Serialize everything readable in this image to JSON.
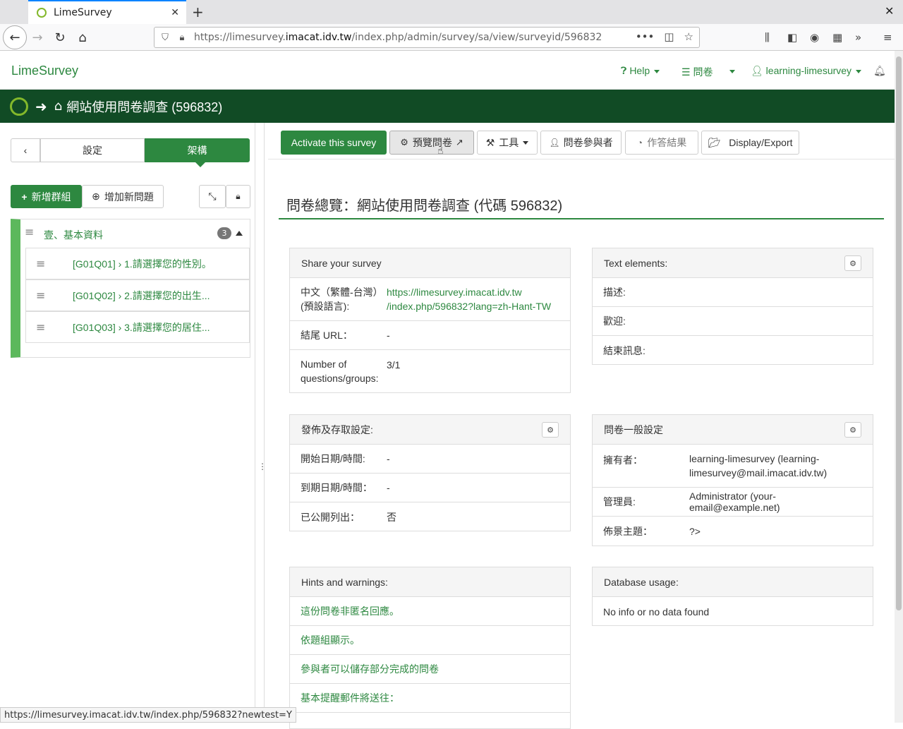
{
  "browser": {
    "tab_title": "LimeSurvey",
    "url_prefix": "https://limesurvey.",
    "url_domain": "imacat.idv.tw",
    "url_path": "/index.php/admin/survey/sa/view/surveyid/596832",
    "status_url": "https://limesurvey.imacat.idv.tw/index.php/596832?newtest=Y"
  },
  "header": {
    "brand": "LimeSurvey",
    "help": "Help",
    "surveys": "問卷",
    "user": "learning-limesurvey"
  },
  "titlebar": {
    "title": "網站使用問卷調查",
    "id": "(596832)"
  },
  "sidebar": {
    "tab_settings": "設定",
    "tab_structure": "架構",
    "add_group": "新增群組",
    "add_question": "增加新問題",
    "group": {
      "name": "壹、基本資料",
      "count": "3",
      "questions": [
        "[G01Q01] › 1.請選擇您的性別。",
        "[G01Q02] › 2.請選擇您的出生...",
        "[G01Q03] › 3.請選擇您的居住..."
      ]
    }
  },
  "toolbar": {
    "activate": "Activate this survey",
    "preview": "預覽問卷",
    "tools": "工具",
    "participants": "問卷參與者",
    "responses": "作答結果",
    "export": "Display/Export"
  },
  "overview": {
    "title_prefix": "問卷總覽：網站使用問卷調查",
    "title_code": "(代碼 596832)"
  },
  "share": {
    "heading": "Share your survey",
    "lang_label": "中文（繁體-台灣）(預設語言):",
    "link_line1": "https://limesurvey.imacat.idv.tw",
    "link_line2": "/index.php/596832?lang=zh-Hant-TW",
    "end_url_label": "結尾 URL：",
    "end_url_value": "-",
    "count_label": "Number of questions/groups:",
    "count_value": "3/1"
  },
  "text_elements": {
    "heading": "Text elements:",
    "description": "描述:",
    "welcome": "歡迎:",
    "end_message": "結束訊息:"
  },
  "publish": {
    "heading": "發佈及存取設定:",
    "start_label": "開始日期/時間:",
    "start_value": "-",
    "expiry_label": "到期日期/時間：",
    "expiry_value": "-",
    "public_label": "已公開列出：",
    "public_value": "否"
  },
  "general": {
    "heading": "問卷一般設定",
    "owner_label": "擁有者：",
    "owner_value_1": "learning-limesurvey (learning-",
    "owner_value_2": "limesurvey@mail.imacat.idv.tw)",
    "admin_label": "管理員:",
    "admin_value": "Administrator (your-email@example.net)",
    "theme_label": "佈景主題：",
    "theme_value": "?>"
  },
  "hints": {
    "heading": "Hints and warnings:",
    "items": [
      "這份問卷非匿名回應。",
      "依題組顯示。",
      "參與者可以儲存部分完成的問卷",
      "基本提醒郵件將送往："
    ]
  },
  "database": {
    "heading": "Database usage:",
    "value": "No info or no data found"
  }
}
